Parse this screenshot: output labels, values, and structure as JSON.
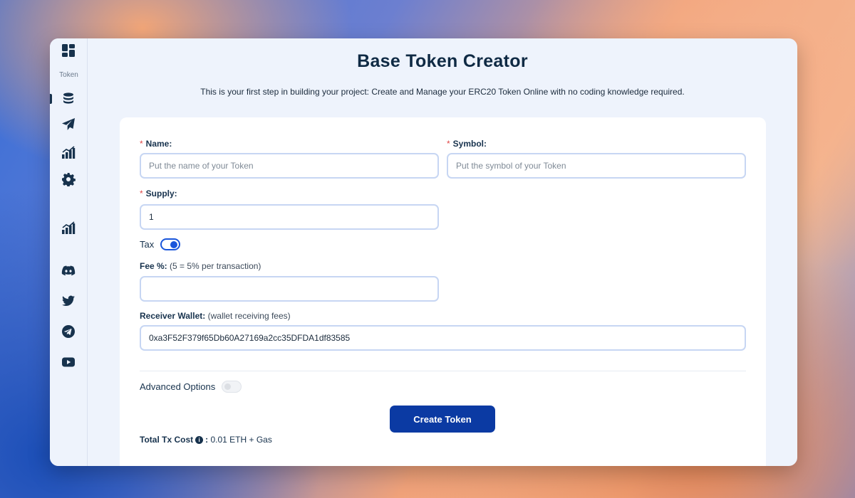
{
  "sidebar": {
    "section_label": "Token",
    "icons": [
      "dashboard-icon",
      "coins-icon",
      "send-icon",
      "chart-icon",
      "gear-icon",
      "chart-icon",
      "discord-icon",
      "twitter-icon",
      "telegram-icon",
      "youtube-icon"
    ]
  },
  "page": {
    "title": "Base Token Creator",
    "subtitle": "This is your first step in building your project: Create and Manage your ERC20 Token Online with no coding knowledge required."
  },
  "form": {
    "name": {
      "required_mark": "*",
      "label": "Name:",
      "placeholder": "Put the name of your Token",
      "value": ""
    },
    "symbol": {
      "required_mark": "*",
      "label": "Symbol:",
      "placeholder": "Put the symbol of your Token",
      "value": ""
    },
    "supply": {
      "required_mark": "*",
      "label": "Supply:",
      "value": "1"
    },
    "tax": {
      "label": "Tax",
      "enabled": true
    },
    "fee": {
      "label": "Fee %:",
      "hint": "(5 = 5% per transaction)",
      "value": ""
    },
    "receiver": {
      "label": "Receiver Wallet:",
      "hint": "(wallet receiving fees)",
      "value": "0xa3F52F379f65Db60A27169a2cc35DFDA1df83585"
    },
    "advanced": {
      "label": "Advanced Options",
      "enabled": false
    },
    "submit_label": "Create Token",
    "cost": {
      "label": "Total Tx Cost",
      "info_glyph": "i",
      "separator": ":",
      "value": "0.01 ETH + Gas"
    }
  },
  "colors": {
    "primary": "#0b3aa3",
    "toggle_on": "#1a56db",
    "required": "#e04646",
    "text_dark": "#17324d"
  }
}
